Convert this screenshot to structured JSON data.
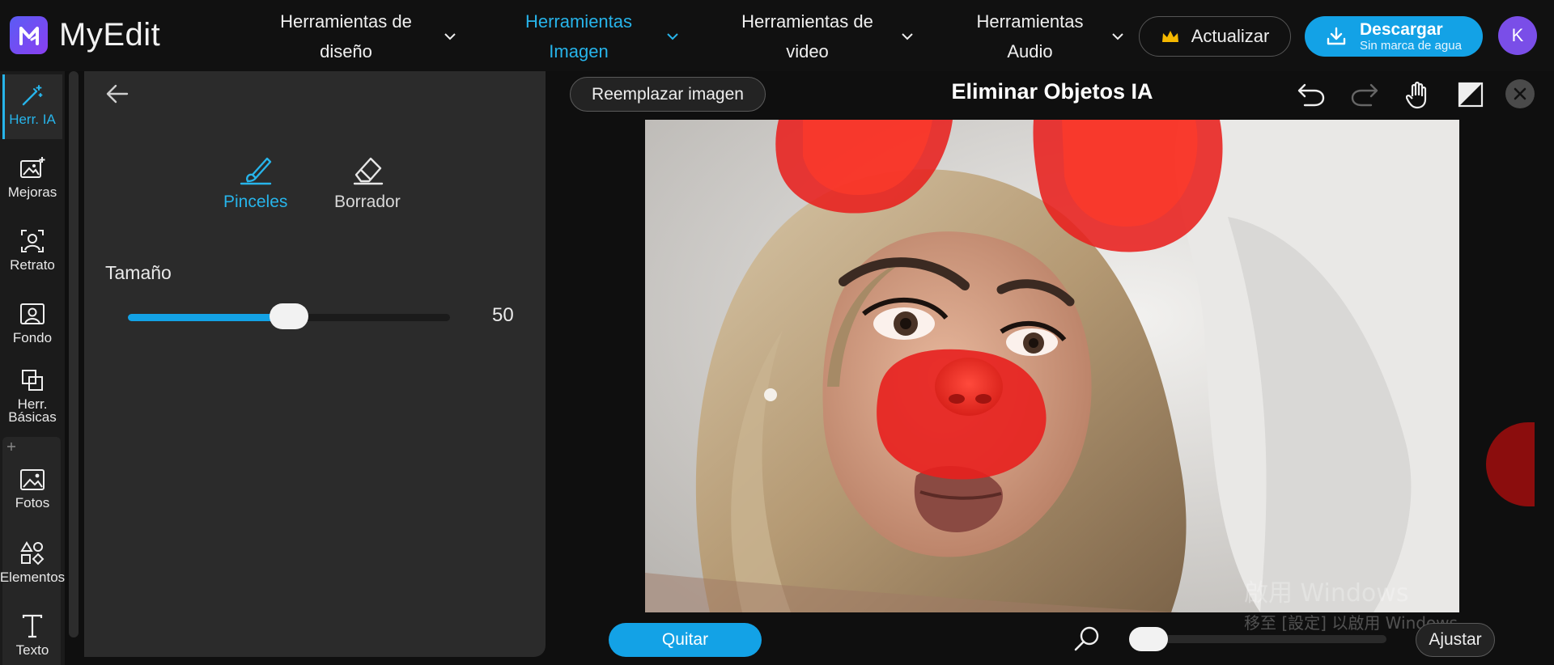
{
  "app": {
    "name": "MyEdit"
  },
  "nav": [
    {
      "label": "Herramientas de diseño",
      "active": false
    },
    {
      "label": "Herramientas Imagen",
      "active": true
    },
    {
      "label": "Herramientas de video",
      "active": false
    },
    {
      "label": "Herramientas Audio",
      "active": false
    }
  ],
  "header": {
    "upgrade_label": "Actualizar",
    "download_label": "Descargar",
    "download_sub": "Sin marca de agua",
    "avatar_initial": "K"
  },
  "rail": [
    {
      "label": "Herr. IA",
      "icon": "magic-wand-icon",
      "active": true
    },
    {
      "label": "Mejoras",
      "icon": "image-sparkle-icon"
    },
    {
      "label": "Retrato",
      "icon": "portrait-icon"
    },
    {
      "label": "Fondo",
      "icon": "background-icon"
    },
    {
      "label": "Herr. Básicas",
      "icon": "crop-icon"
    },
    {
      "label": "Fotos",
      "icon": "photo-icon"
    },
    {
      "label": "Elementos",
      "icon": "shapes-icon"
    },
    {
      "label": "Texto",
      "icon": "text-icon"
    }
  ],
  "panel": {
    "tools": [
      {
        "label": "Pinceles",
        "icon": "brush-icon",
        "active": true
      },
      {
        "label": "Borrador",
        "icon": "eraser-icon",
        "active": false
      }
    ],
    "size_label": "Tamaño",
    "size_value": "50",
    "size_fraction": 0.5
  },
  "editor": {
    "replace_label": "Reemplazar imagen",
    "title": "Eliminar Objetos IA",
    "remove_label": "Quitar",
    "fit_label": "Ajustar",
    "zoom_fraction": 0.0
  },
  "watermark": {
    "line1": "啟用 Windows",
    "line2": "移至 [設定] 以啟用 Windows。"
  },
  "colors": {
    "accent": "#13a2e6",
    "accent_text": "#27b4ea",
    "avatar": "#7a4ee8",
    "mask": "#e8201e"
  }
}
